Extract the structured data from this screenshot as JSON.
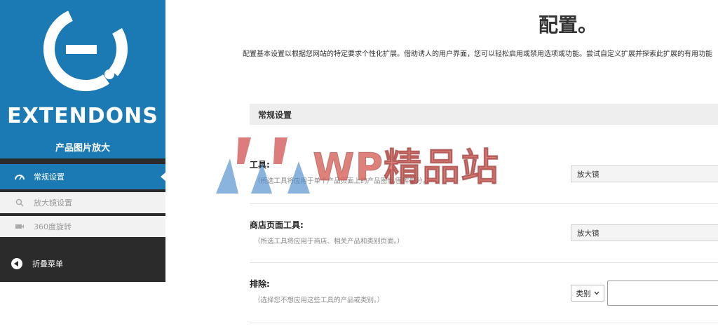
{
  "colors": {
    "brand_blue": "#1b7ab3",
    "sidebar_dark": "#2b2b2b",
    "section_bg": "#eeeeee"
  },
  "sidebar": {
    "brand_name": "EXTENDONS",
    "brand_subtitle": "产品图片放大",
    "items": [
      {
        "label": "常规设置",
        "icon": "gauge-icon"
      },
      {
        "label": "放大镜设置",
        "icon": "search-icon"
      },
      {
        "label": "360度旋转",
        "icon": "rotate-icon"
      }
    ],
    "collapse_label": "折叠菜单"
  },
  "main": {
    "title": "配置。",
    "description": "配置基本设置以根据您网站的特定要求个性化扩展。借助诱人的用户界面，您可以轻松启用或禁用选项或功能。尝试自定义扩展并探索此扩展的有用功能。",
    "section_title": "常规设置",
    "rows": [
      {
        "label": "工具:",
        "help": "（所选工具将应用于单个产品页面上的产品图像/图库部分。）",
        "value": "放大镜"
      },
      {
        "label": "商店页面工具:",
        "help": "（所选工具将应用于商店、相关产品和类别页面。）",
        "value": "放大镜"
      },
      {
        "label": "排除:",
        "help": "（选择您不想应用这些工具的产品或类别。）",
        "dropdown_value": "类别"
      }
    ]
  },
  "watermark": {
    "text": "WP精品站"
  }
}
